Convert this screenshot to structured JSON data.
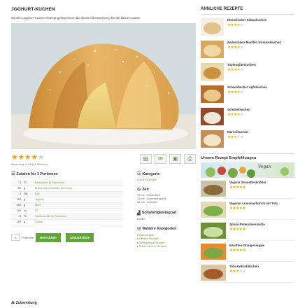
{
  "main": {
    "title": "JOGHURT-KUCHEN",
    "intro": "Mit dem Joghurt-Kuchen Rezept gelingt Ihnen die ideale Überraschung für die kleinen Gäste.",
    "rating": {
      "stars": 4,
      "max": 5,
      "note": "Bewertung: ø 3,6 (16 Stimmen)"
    },
    "tools": [
      "print-view-icon",
      "email-icon",
      "save-icon",
      "printer-icon"
    ]
  },
  "ingredients": {
    "heading": "Zutaten für 1 Portionen",
    "rows": [
      {
        "qty": "3",
        "unit": "TL",
        "name": "Backpulver (1 Packchen)"
      },
      {
        "qty": "20",
        "unit": "g",
        "name": "Butter (zum Einfetten der Form)"
      },
      {
        "qty": "4",
        "unit": "Stk",
        "name": "Eier"
      },
      {
        "qty": "250",
        "unit": "g",
        "name": "Joghurt"
      },
      {
        "qty": "400",
        "unit": "g",
        "name": "Mehl"
      },
      {
        "qty": "100",
        "unit": "ml",
        "name": "Öl"
      },
      {
        "qty": "3",
        "unit": "TL",
        "name": "Vanillezucker (1 Packchen)"
      },
      {
        "qty": "300",
        "unit": "g",
        "name": "Zucker"
      }
    ],
    "portion_value": "1",
    "portion_label": "Portionen",
    "calc_button": "Berechnen",
    "shop_button": "Einkaufsliste"
  },
  "info": {
    "category_heading": "Kategorie",
    "category_value": "Kuchen Rezepte",
    "time_heading": "Zeit",
    "time_lines": [
      "75 min. Gesamtzeit",
      "15 min. Zubereitungszeit",
      "60 min. Kochzeit"
    ],
    "difficulty_heading": "Schwierigkeitsgrad",
    "difficulty_value": "einfach",
    "more_heading": "Weitere Kategorien",
    "more_items": [
      "Backrezepte",
      "Dessert Rezepte",
      "Mehlspeisen Rezepte",
      "Süsse Kuchen Rezepte"
    ]
  },
  "preparation_heading": "Zubereitung",
  "sidebar": {
    "similar_title": "ÄHNLICHE REZEPTE",
    "similar": [
      {
        "name": "Himmlischer Kokoskuchen",
        "stars": 4
      },
      {
        "name": "Zwetschken-Marillen Streuselkuchen",
        "stars": 4
      },
      {
        "name": "Topfengitterkuchen",
        "stars": 4
      },
      {
        "name": "Schwedischer Apfelkuchen",
        "stars": 4
      },
      {
        "name": "Schüttelkuchen",
        "stars": 4
      },
      {
        "name": "Maronikuchen",
        "stars": 3
      }
    ],
    "emp_title": "Unsere Rezept Empfehlungen",
    "banner_text": "Vegan",
    "emp": [
      {
        "name": "Vegane Serviettenknödel",
        "stars": 5
      },
      {
        "name": "Veganer Linsenaufstrich mit Tofu",
        "stars": 5
      },
      {
        "name": "Spinat-Petersilienrisotto",
        "stars": 5
      },
      {
        "name": "Karotten-Orangensuppe",
        "stars": 5
      },
      {
        "name": "Tofu-Kokosbällchen",
        "stars": 3
      }
    ]
  },
  "colors": {
    "accent_green": "#5fa933",
    "star_gold": "#f0a500"
  }
}
